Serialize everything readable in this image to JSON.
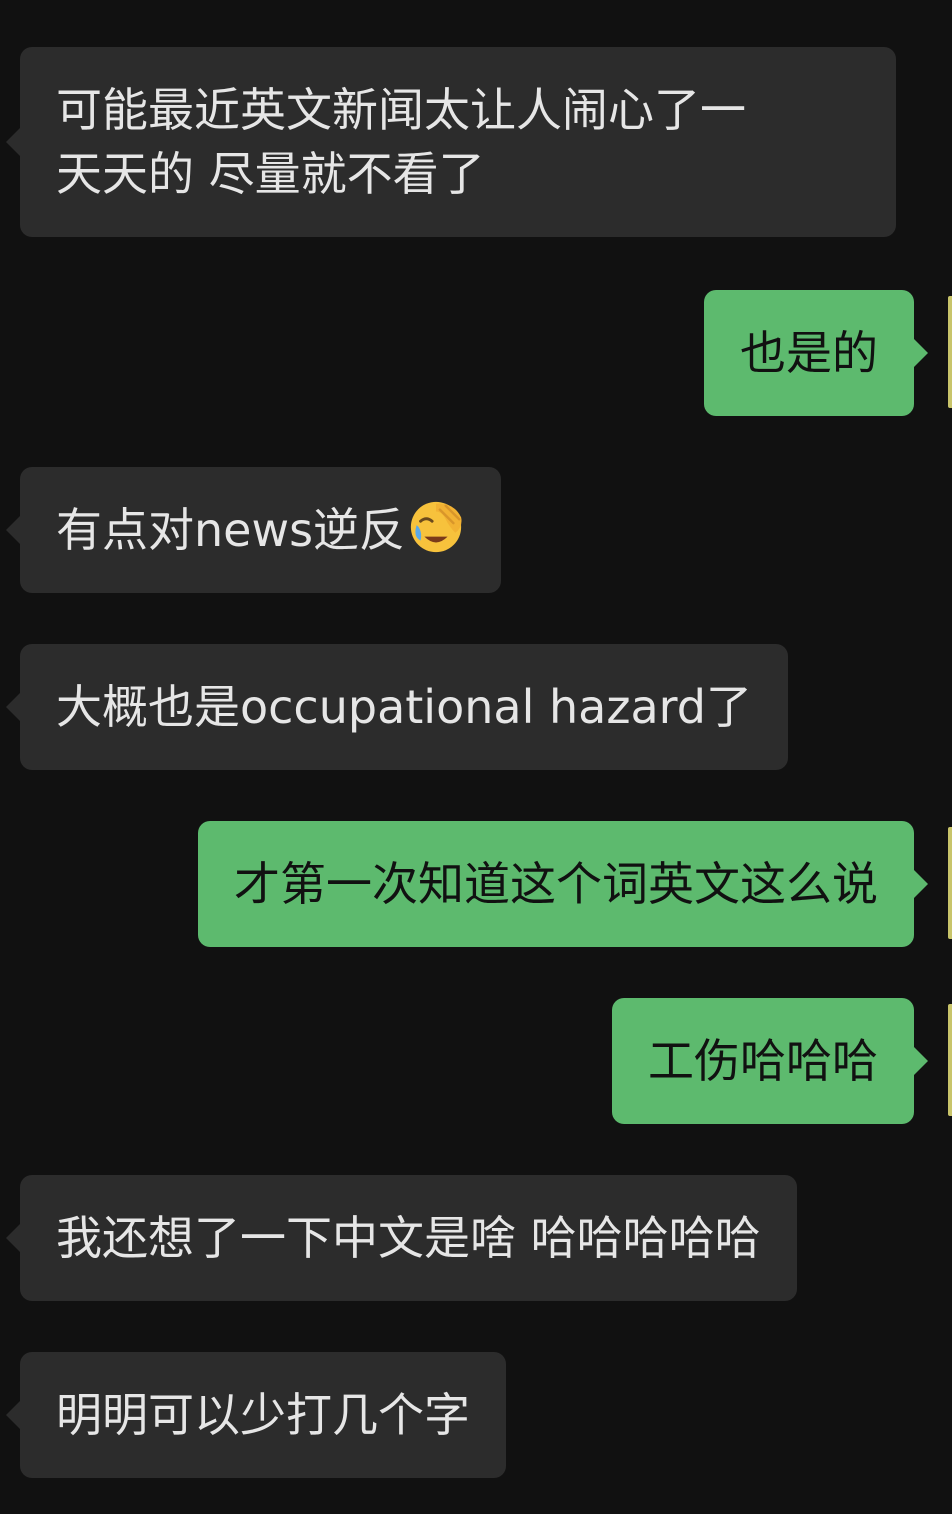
{
  "messages": [
    {
      "side": "in",
      "lines": [
        "可能最近英文新闻太让人闹心了一",
        "天天的 尽量就不看了"
      ]
    },
    {
      "side": "out",
      "text": "也是的"
    },
    {
      "side": "in",
      "text": "有点对news逆反",
      "emoji": "face-palm-tears-emoji"
    },
    {
      "side": "in",
      "text": "大概也是occupational hazard了"
    },
    {
      "side": "out",
      "text": "才第一次知道这个词英文这么说"
    },
    {
      "side": "out",
      "text": "工伤哈哈哈"
    },
    {
      "side": "in",
      "text": "我还想了一下中文是啥 哈哈哈哈哈"
    },
    {
      "side": "in",
      "text": "明明可以少打几个字"
    }
  ],
  "colors": {
    "background": "#111111",
    "incoming_bubble": "#2c2c2c",
    "outgoing_bubble": "#5dba6e",
    "incoming_text": "#e6e6e6",
    "outgoing_text": "#111111"
  }
}
